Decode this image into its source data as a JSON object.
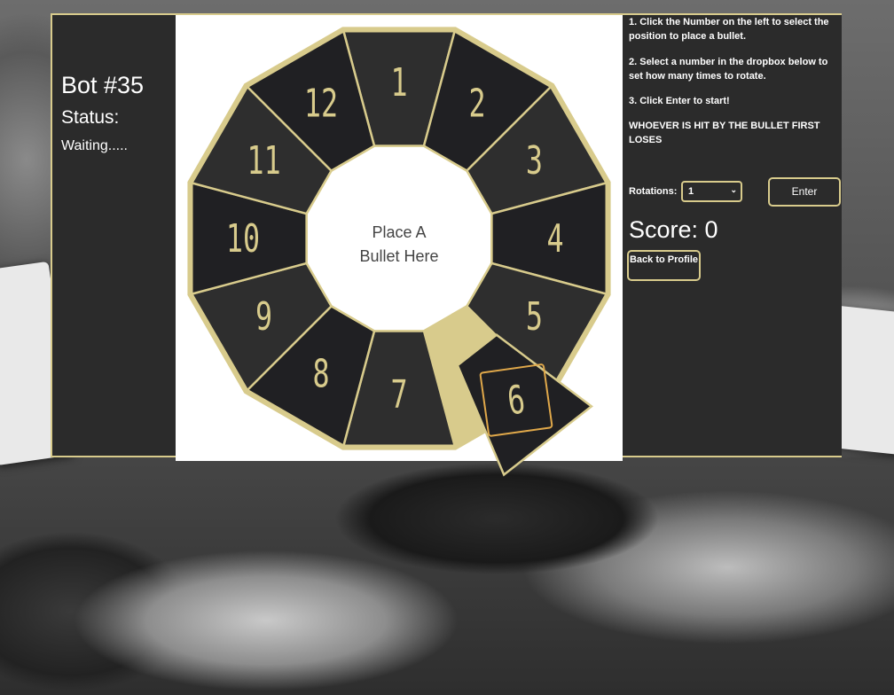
{
  "player": {
    "name": "Bot #35",
    "status_label": "Status:",
    "status_value": "Waiting....."
  },
  "board": {
    "center_line1": "Place A",
    "center_line2": "Bullet Here",
    "segments": [
      "1",
      "2",
      "3",
      "4",
      "5",
      "6",
      "7",
      "8",
      "9",
      "10",
      "11",
      "12"
    ],
    "selected_segment": "6",
    "colors": {
      "gold": "#d8cb8c",
      "segment_dark": "#202023",
      "segment_mid": "#2e2e2e",
      "highlight": "#e0a84a"
    }
  },
  "instructions": {
    "step1_prefix": "1. Click the ",
    "step1_bold": "Number",
    "step1_suffix": " on the left to select the position to place a bullet.",
    "step2_prefix": "2. Select a number in the ",
    "step2_bold": "dropbox",
    "step2_suffix": " below to set how many times to rotate.",
    "step3": "3. Click Enter to start!",
    "warning": "WHOEVER IS HIT BY THE BULLET FIRST LOSES"
  },
  "controls": {
    "rotations_label": "Rotations:",
    "rotations_value": "1",
    "enter_label": "Enter",
    "back_label": "Back to Profile"
  },
  "score": {
    "text": "Score: 0"
  }
}
